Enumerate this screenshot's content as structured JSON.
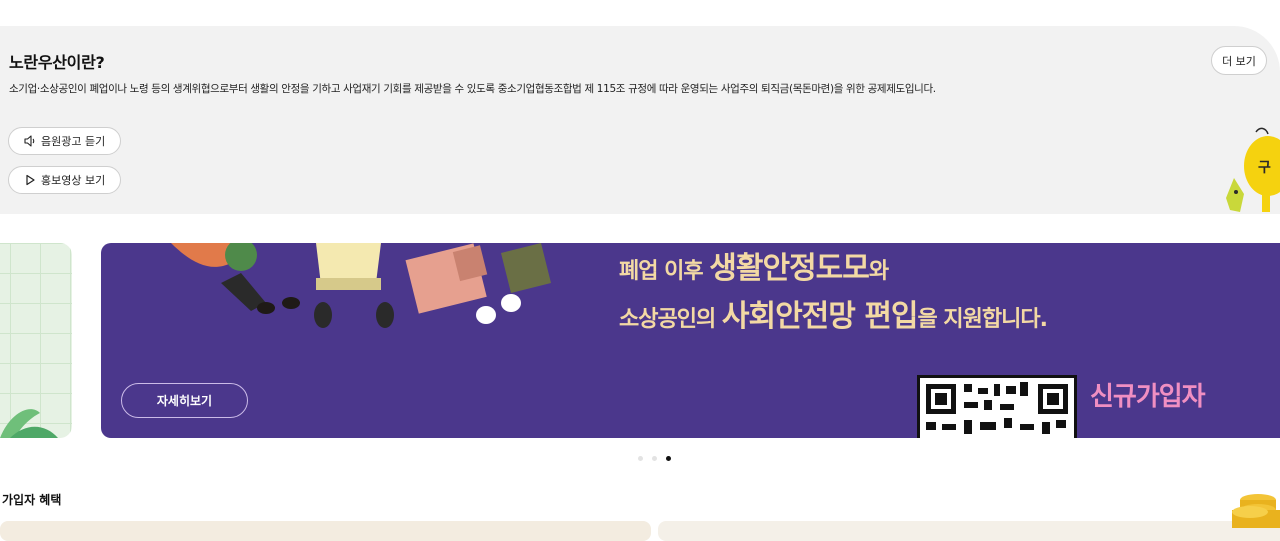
{
  "intro": {
    "title": "노란우산이란?",
    "description": "소기업·소상공인이 폐업이나 노령 등의 생계위협으로부터 생활의 안정을 기하고 사업재기 기회를 제공받을 수 있도록 중소기업협동조합법 제 115조 규정에 따라 운영되는 사업주의 퇴직금(목돈마련)을 위한 공제제도입니다.",
    "more_label": "더 보기",
    "audio_label": "음원광고 듣기",
    "video_label": "홍보영상 보기"
  },
  "banner": {
    "line1_prefix": "폐업 이후 ",
    "line1_highlight": "생활안정도모",
    "line1_suffix": "와",
    "line2_prefix": "소상공인의 ",
    "line2_highlight": "사회안전망 편입",
    "line2_suffix": "을 지원합니다.",
    "new_member": "신규가입자",
    "detail_label": "자세히보기",
    "slide_count": 3,
    "active_slide": 3
  },
  "benefits": {
    "title": "가입자 혜택"
  },
  "colors": {
    "banner_bg": "#4b378c",
    "banner_text": "#f3d9a4",
    "new_member": "#f08fc2",
    "panel_bg": "#f2f2f2",
    "mascot": "#f5d20f"
  }
}
